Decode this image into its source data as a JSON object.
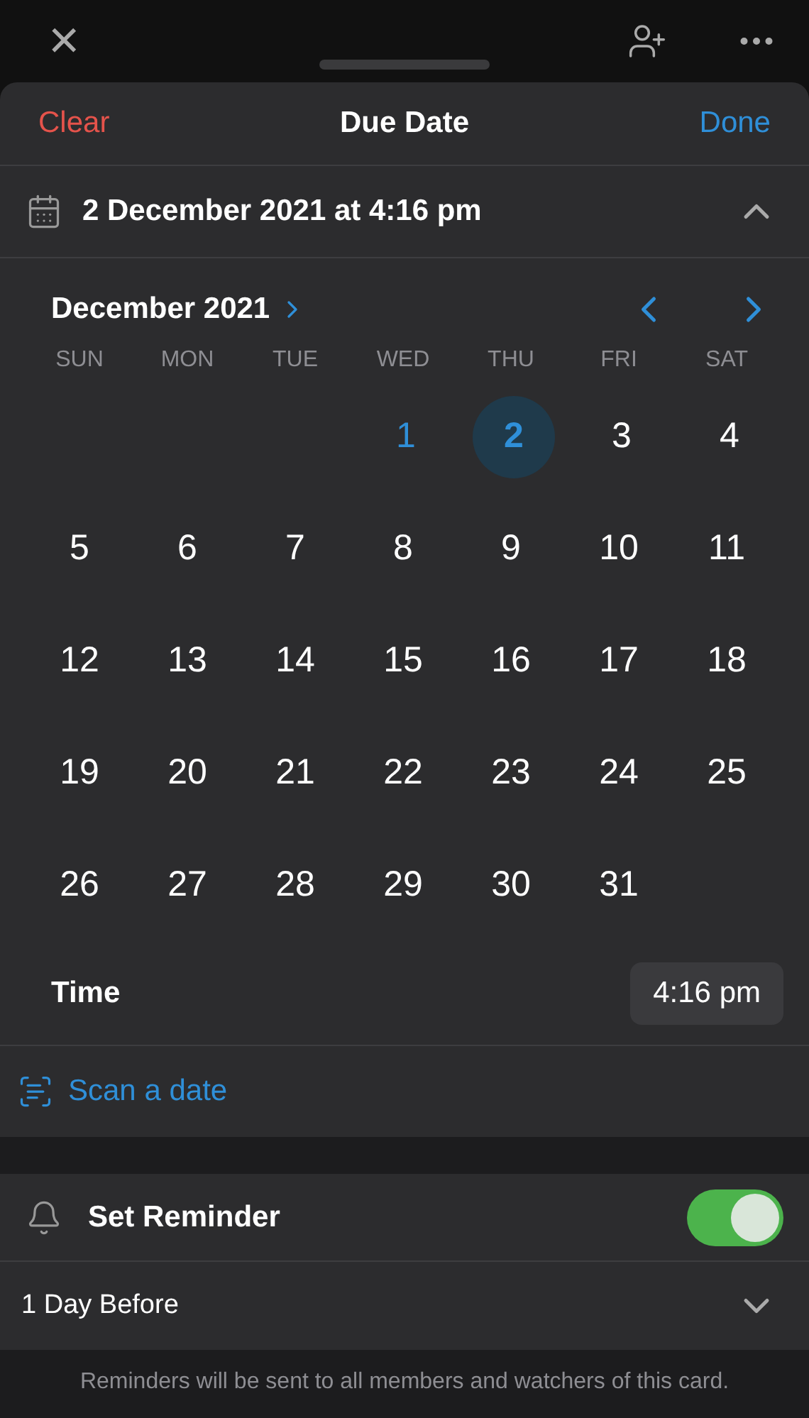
{
  "top_bar": {
    "close": "×"
  },
  "header": {
    "clear": "Clear",
    "title": "Due Date",
    "done": "Done"
  },
  "date_row": {
    "value": "2 December 2021 at 4:16 pm",
    "expanded": true
  },
  "calendar": {
    "month": "December 2021",
    "weekdays": [
      "SUN",
      "MON",
      "TUE",
      "WED",
      "THU",
      "FRI",
      "SAT"
    ],
    "weeks": [
      {
        "days": [
          {
            "label": "1",
            "today": true,
            "selected": false
          },
          {
            "label": "2",
            "today": false,
            "selected": true
          },
          {
            "label": "3",
            "today": false,
            "selected": false
          },
          {
            "label": "4",
            "today": false,
            "selected": false
          }
        ]
      },
      {
        "days": [
          {
            "label": "5",
            "today": false,
            "selected": false
          },
          {
            "label": "6",
            "today": false,
            "selected": false
          },
          {
            "label": "7",
            "today": false,
            "selected": false
          },
          {
            "label": "8",
            "today": false,
            "selected": false
          },
          {
            "label": "9",
            "today": false,
            "selected": false
          },
          {
            "label": "10",
            "today": false,
            "selected": false
          },
          {
            "label": "11",
            "today": false,
            "selected": false
          }
        ]
      },
      {
        "days": [
          {
            "label": "12",
            "today": false,
            "selected": false
          },
          {
            "label": "13",
            "today": false,
            "selected": false
          },
          {
            "label": "14",
            "today": false,
            "selected": false
          },
          {
            "label": "15",
            "today": false,
            "selected": false
          },
          {
            "label": "16",
            "today": false,
            "selected": false
          },
          {
            "label": "17",
            "today": false,
            "selected": false
          },
          {
            "label": "18",
            "today": false,
            "selected": false
          }
        ]
      },
      {
        "days": [
          {
            "label": "19",
            "today": false,
            "selected": false
          },
          {
            "label": "20",
            "today": false,
            "selected": false
          },
          {
            "label": "21",
            "today": false,
            "selected": false
          },
          {
            "label": "22",
            "today": false,
            "selected": false
          },
          {
            "label": "23",
            "today": false,
            "selected": false
          },
          {
            "label": "24",
            "today": false,
            "selected": false
          },
          {
            "label": "25",
            "today": false,
            "selected": false
          }
        ]
      },
      {
        "days": [
          {
            "label": "26",
            "today": false,
            "selected": false
          },
          {
            "label": "27",
            "today": false,
            "selected": false
          },
          {
            "label": "28",
            "today": false,
            "selected": false
          },
          {
            "label": "29",
            "today": false,
            "selected": false
          },
          {
            "label": "30",
            "today": false,
            "selected": false
          },
          {
            "label": "31",
            "today": false,
            "selected": false
          }
        ]
      }
    ]
  },
  "time": {
    "label": "Time",
    "value": "4:16 pm"
  },
  "scan": {
    "label": "Scan a date"
  },
  "reminder": {
    "label": "Set Reminder",
    "on": true,
    "option": "1 Day Before"
  },
  "footer": "Reminders will be sent to all members and watchers of this card."
}
